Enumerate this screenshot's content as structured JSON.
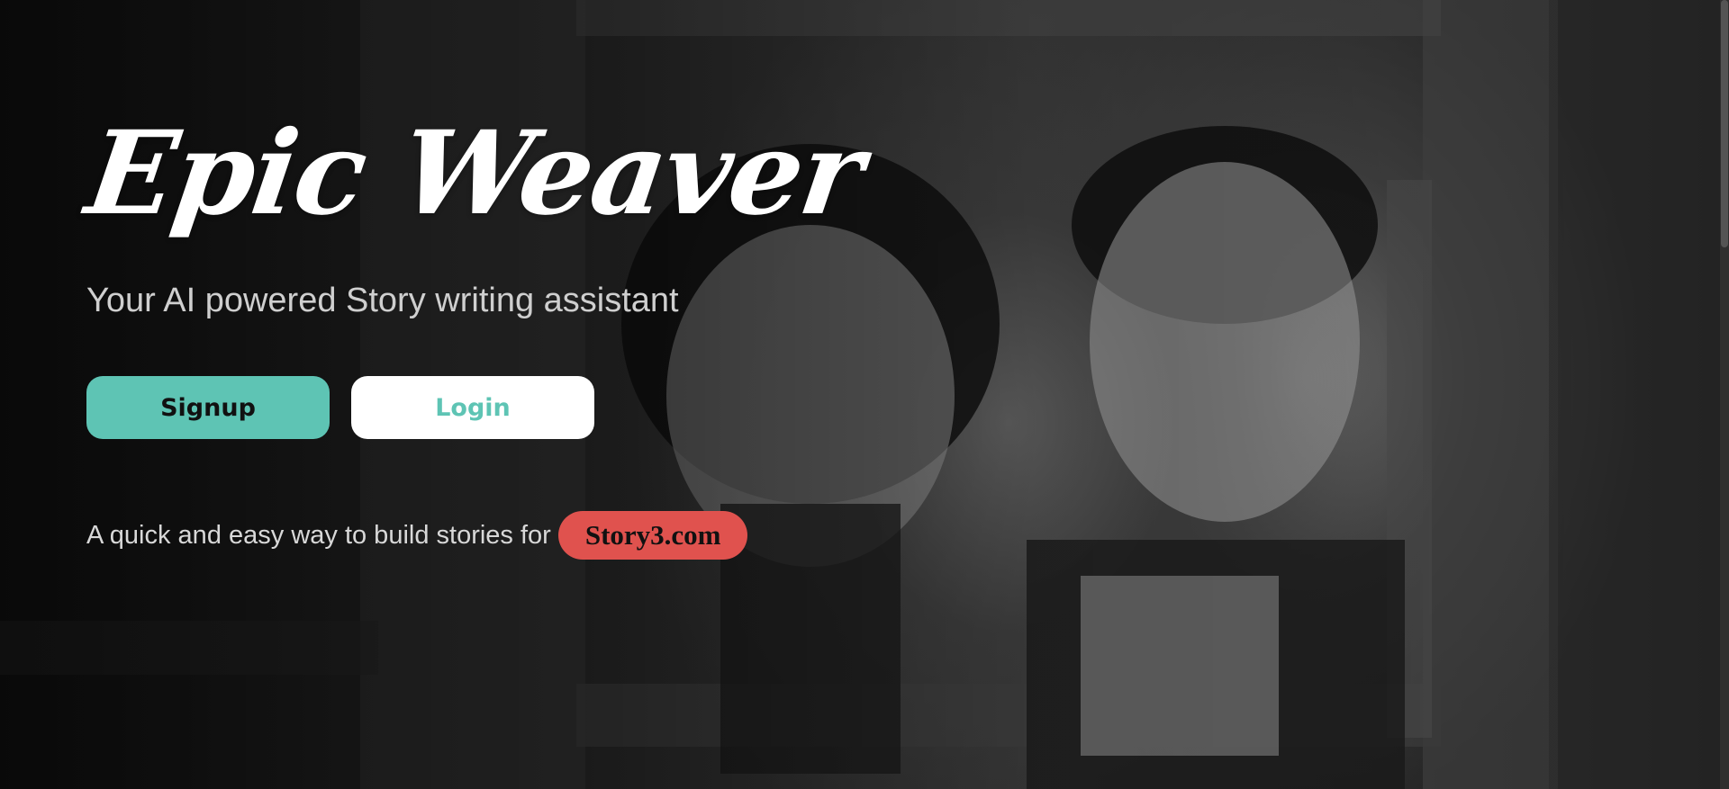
{
  "brand": {
    "title": "Epic Weaver"
  },
  "hero": {
    "tagline": "Your AI powered Story writing assistant",
    "signup_label": "Signup",
    "login_label": "Login",
    "footer_text": "A quick and easy way to build stories for",
    "story_link_label": "Story3.com"
  },
  "colors": {
    "accent_teal": "#5ec4b4",
    "accent_red": "#e0524e",
    "text_white": "#ffffff"
  }
}
